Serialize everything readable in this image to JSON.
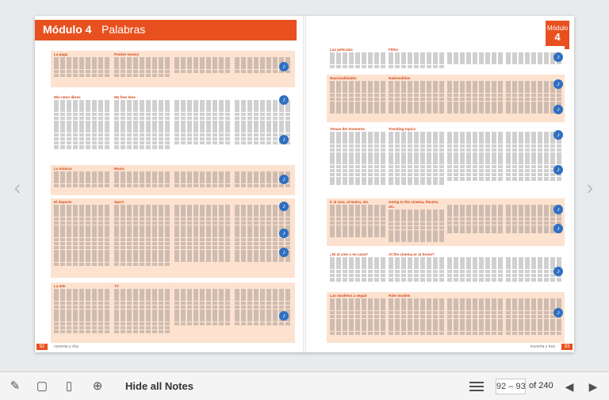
{
  "module": {
    "label": "Módulo 4",
    "title": "Palabras",
    "tab_label": "Módulo",
    "tab_number": "4"
  },
  "left_sections": [
    {
      "heading": "La paga",
      "col2": "Pocket money"
    },
    {
      "heading": "Mis ratos libres",
      "col2": "My free time"
    },
    {
      "heading": "La música",
      "col2": "Music"
    },
    {
      "heading": "El deporte",
      "col2": "Sport"
    },
    {
      "heading": "La tele",
      "col2": "TV"
    }
  ],
  "right_sections": [
    {
      "heading": "Las películas",
      "col2": "Films"
    },
    {
      "heading": "Nacionalidades",
      "col2": "Nationalities"
    },
    {
      "heading": "Temas del momento",
      "col2": "Trending topics"
    },
    {
      "heading": "Ir al cine, al teatro, etc.",
      "col2": "Going to the cinema, theatre, etc."
    },
    {
      "heading": "¿Ni al cine o en casa?",
      "col2": "At the cinema or at home?"
    },
    {
      "heading": "Las modelos a seguir",
      "col2": "Role models"
    }
  ],
  "left_page_number": "92",
  "right_page_number": "93",
  "footer_left": "noventa y dos",
  "footer_right": "noventa y tres",
  "toolbar": {
    "hide_notes": "Hide all Notes",
    "page_range": "92 – 93",
    "of_total": "of 240"
  }
}
